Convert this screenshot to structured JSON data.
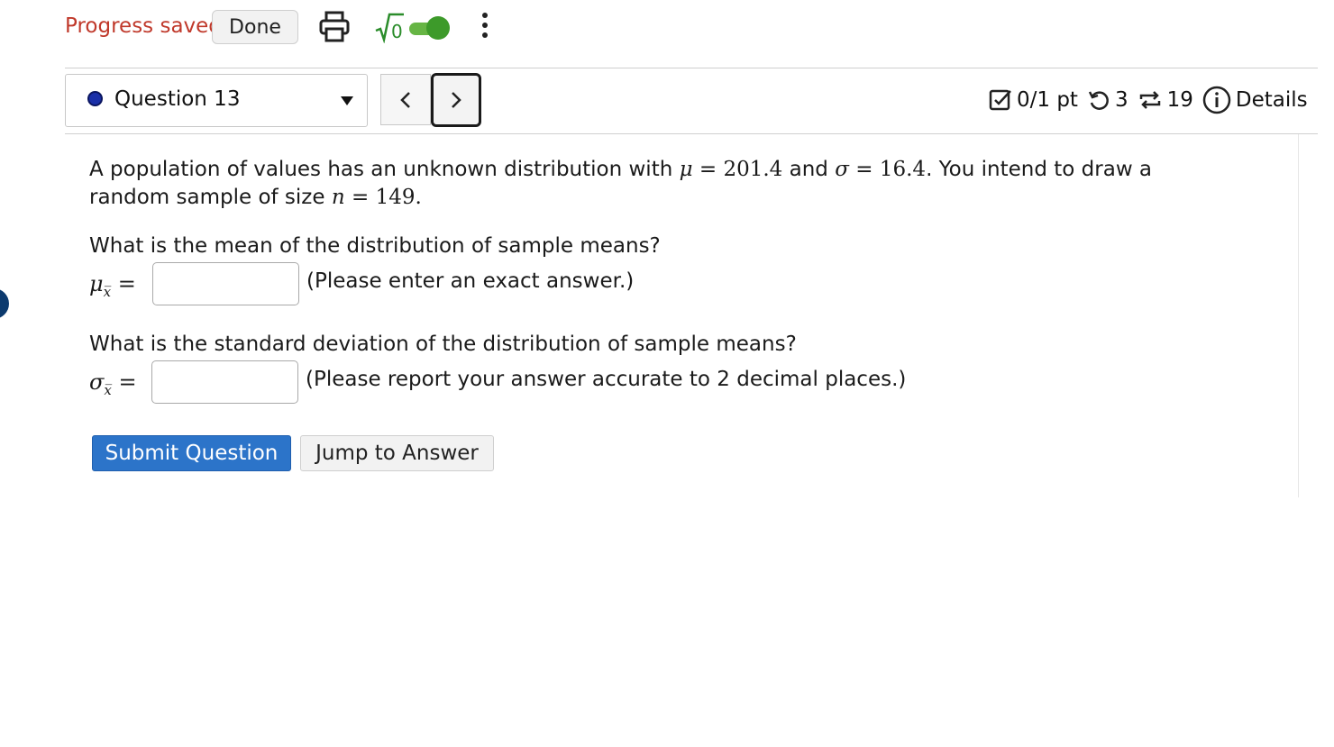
{
  "topbar": {
    "progress_text": "Progress saved",
    "done_label": "Done",
    "sqrt_label": "√0"
  },
  "question_bar": {
    "question_label": "Question 13",
    "score": "0/1 pt",
    "retries": "3",
    "submissions": "19",
    "details_label": "Details"
  },
  "problem": {
    "intro_a": "A population of values has an unknown distribution with ",
    "mu_symbol": "μ",
    "eq": "=",
    "mu_value": "201.4",
    "and": " and ",
    "sigma_symbol": "σ",
    "sigma_value": "16.4",
    "intro_b": ". You intend to draw a random sample of size ",
    "n_symbol": "n",
    "n_value": "149",
    "period": ".",
    "q1_text": "What is the mean of the distribution of sample means?",
    "q1_symbol": "μ",
    "q1_hint": "(Please enter an exact answer.)",
    "q2_text": "What is the standard deviation of the distribution of sample means?",
    "q2_symbol": "σ",
    "q2_hint": "(Please report your answer accurate to 2 decimal places.)",
    "subscript": "x̅"
  },
  "actions": {
    "submit_label": "Submit Question",
    "jump_label": "Jump to Answer"
  },
  "colors": {
    "saved": "#c0392b",
    "toggle": "#3d9a2a",
    "submit": "#2c74c9",
    "question_dot": "#1a2fa8"
  }
}
